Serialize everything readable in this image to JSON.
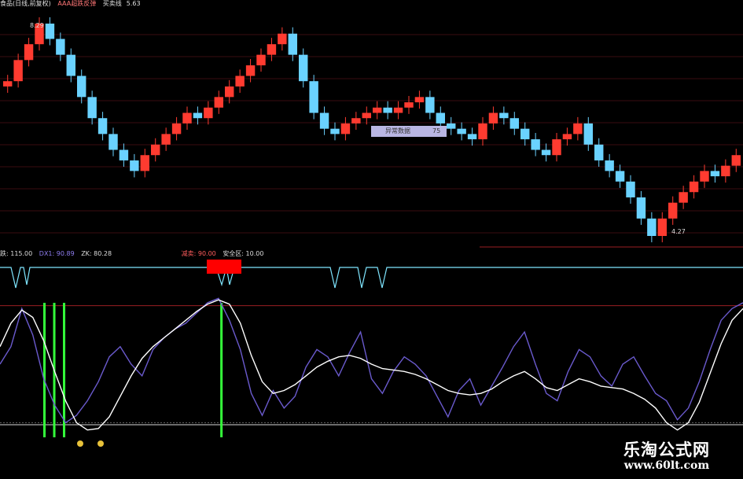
{
  "top_header": {
    "title": "食品(日线,前复权)",
    "indicator": "AAA超跌反弹",
    "line_label": "买卖线",
    "line_value": "5.63"
  },
  "price_labels": {
    "high": "8.29",
    "low": "4.27"
  },
  "box_label": {
    "text": "异常数据",
    "value": "75"
  },
  "lower_header": {
    "item1": "跌",
    "item1_value": ": 115.00",
    "item2": "DX1: 90.89",
    "item3": "ZK: 80.28",
    "item4": "减卖: 90.00",
    "item5": "安全区: 10.00"
  },
  "watermark": {
    "line1": "乐淘公式网",
    "line2": "www.60lt.com"
  },
  "colors": {
    "background": "#000000",
    "up_candle": "#ff3b30",
    "down_candle": "#6ad2ff",
    "purple_line": "#6a5acd",
    "white_line": "#ffffff",
    "green_bar": "#34ff3a",
    "red_line": "#9a1e22",
    "cyan_line": "#7fe6ff",
    "red_block": "#ff0000"
  },
  "chart_data": [
    {
      "type": "candlestick",
      "title": "",
      "price_high": 8.29,
      "price_low": 4.27,
      "close_series": [
        7.2,
        7.6,
        7.9,
        8.29,
        8.0,
        7.7,
        7.3,
        6.9,
        6.5,
        6.2,
        5.9,
        5.7,
        5.5,
        5.8,
        6.0,
        6.2,
        6.4,
        6.6,
        6.5,
        6.7,
        6.9,
        7.1,
        7.3,
        7.5,
        7.7,
        7.9,
        8.1,
        7.7,
        7.2,
        6.6,
        6.3,
        6.2,
        6.4,
        6.5,
        6.6,
        6.7,
        6.6,
        6.7,
        6.8,
        6.9,
        6.6,
        6.4,
        6.3,
        6.2,
        6.1,
        6.4,
        6.6,
        6.5,
        6.3,
        6.1,
        5.9,
        5.8,
        6.1,
        6.2,
        6.4,
        6.0,
        5.7,
        5.5,
        5.3,
        5.0,
        4.6,
        4.27,
        4.6,
        4.9,
        5.1,
        5.3,
        5.5,
        5.4,
        5.6,
        5.8
      ]
    },
    {
      "type": "line",
      "title": "",
      "ylim": [
        0,
        100
      ],
      "reference_lines": {
        "upper": 90,
        "lower": 10
      },
      "series": [
        {
          "values": [
            50,
            62,
            88,
            70,
            40,
            22,
            10,
            15,
            25,
            38,
            55,
            62,
            50,
            42,
            60,
            68,
            74,
            78,
            85,
            92,
            95,
            80,
            60,
            30,
            15,
            32,
            20,
            28,
            48,
            60,
            55,
            42,
            58,
            72,
            40,
            30,
            45,
            55,
            50,
            42,
            28,
            14,
            32,
            40,
            22,
            35,
            48,
            62,
            72,
            50,
            30,
            25,
            45,
            60,
            55,
            42,
            35,
            50,
            55,
            42,
            30,
            25,
            12,
            20,
            38,
            60,
            80,
            88,
            92
          ]
        },
        {
          "values": [
            62,
            78,
            87,
            82,
            66,
            45,
            25,
            10,
            5,
            6,
            14,
            28,
            42,
            54,
            62,
            68,
            74,
            80,
            86,
            91,
            94,
            91,
            78,
            56,
            38,
            30,
            32,
            36,
            42,
            48,
            52,
            55,
            56,
            54,
            50,
            47,
            46,
            45,
            43,
            40,
            36,
            32,
            30,
            29,
            30,
            33,
            38,
            42,
            45,
            40,
            34,
            32,
            36,
            40,
            38,
            35,
            34,
            33,
            30,
            26,
            20,
            10,
            5,
            10,
            24,
            44,
            64,
            80,
            88
          ]
        }
      ],
      "signal_bars": [
        2,
        3,
        4,
        20
      ]
    }
  ]
}
